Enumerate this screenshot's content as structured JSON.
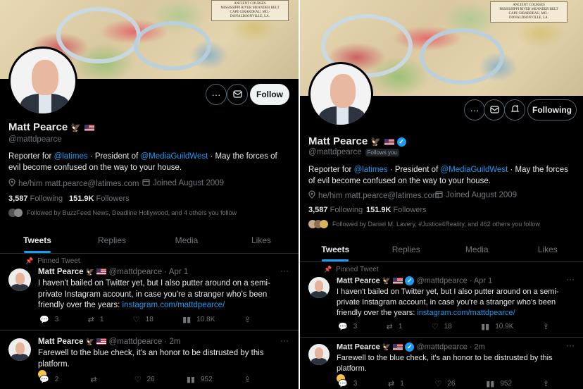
{
  "left": {
    "profile": {
      "name": "Matt Pearce",
      "handle": "@mattdpearce",
      "bio_pre": "Reporter for ",
      "bio_link1": "@latimes",
      "bio_mid": " · President of ",
      "bio_link2": "@MediaGuildWest",
      "bio_post": " · May the forces of evil become confused on the way to your house.",
      "location": "he/him matt.pearce@latimes.com",
      "joined": "Joined August 2009",
      "following_count": "3,587",
      "following_label": "Following",
      "followers_count": "151.9K",
      "followers_label": "Followers",
      "followed_by": "Followed by BuzzFeed News, Deadline Hollywood, and 4 others you follow"
    },
    "buttons": {
      "follow": "Follow"
    },
    "tabs": [
      "Tweets",
      "Replies",
      "Media",
      "Likes"
    ],
    "pinned_label": "Pinned Tweet",
    "tweets": [
      {
        "name": "Matt Pearce",
        "handle": "@mattdpearce · Apr 1",
        "text": "I haven't bailed on Twitter yet, but I also putter around on a semi-private Instagram account, in case you're a stranger who's been friendly over the years: ",
        "link": "instagram.com/mattdpearce/",
        "replies": "3",
        "retweets": "1",
        "likes": "18",
        "views": "10.8K"
      },
      {
        "name": "Matt Pearce",
        "handle": "@mattdpearce · 2m",
        "text": "Farewell to the blue check, it's an honor to be distrusted by this platform.",
        "replies": "2",
        "retweets": "",
        "likes": "26",
        "views": "952"
      }
    ]
  },
  "right": {
    "profile": {
      "name": "Matt Pearce",
      "handle": "@mattdpearce",
      "follows_you": "Follows you",
      "bio_pre": "Reporter for ",
      "bio_link1": "@latimes",
      "bio_mid": " · President of ",
      "bio_link2": "@MediaGuildWest",
      "bio_post": " · May the forces of evil become confused on the way to your house.",
      "location": "he/him matt.pearce@latimes.com",
      "joined": "Joined August 2009",
      "following_count": "3,587",
      "following_label": "Following",
      "followers_count": "151.9K",
      "followers_label": "Followers",
      "followed_by": "Followed by Daniel M. Lavery, #Justice4Reality, and 462 others you follow"
    },
    "buttons": {
      "following": "Following"
    },
    "tabs": [
      "Tweets",
      "Replies",
      "Media",
      "Likes"
    ],
    "pinned_label": "Pinned Tweet",
    "tweets": [
      {
        "name": "Matt Pearce",
        "handle": "@mattdpearce · Apr 1",
        "text": "I haven't bailed on Twitter yet, but I also putter around on a semi-private Instagram account, in case you're a stranger who's been friendly over the years: ",
        "link": "instagram.com/mattdpearce/",
        "replies": "3",
        "retweets": "1",
        "likes": "18",
        "views": "10.9K"
      },
      {
        "name": "Matt Pearce",
        "handle": "@mattdpearce · 2m",
        "text": "Farewell to the blue check, it's an honor to be distrusted by this platform.",
        "replies": "3",
        "retweets": "1",
        "likes": "26",
        "views": "952"
      }
    ]
  },
  "banner_plate": {
    "line1": "ANCIENT COURSES",
    "line2": "MISSISSIPPI RIVER MEANDER BELT",
    "line3": "CAPE GIRARDEAU, MO.-DONALDSONVILLE, LA."
  },
  "colors": {
    "accent": "#1d9bf0",
    "background": "#000000",
    "muted": "#71767b",
    "text": "#e7e9ea"
  },
  "icons": [
    "more-icon",
    "mail-icon",
    "bell-plus-icon",
    "location-icon",
    "calendar-icon",
    "pin-icon",
    "reply-icon",
    "retweet-icon",
    "like-icon",
    "views-icon",
    "share-icon",
    "verified-icon",
    "us-flag-icon",
    "eagle-emoji-icon"
  ]
}
